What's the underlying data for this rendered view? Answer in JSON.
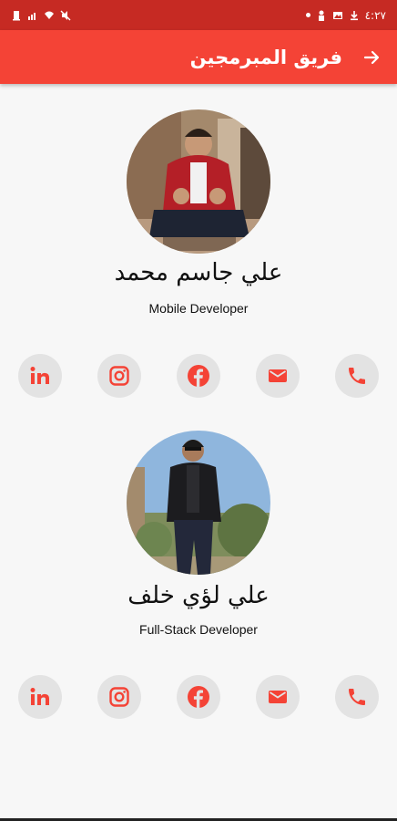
{
  "status_bar": {
    "time": "٤:٢٧",
    "icons_left": [
      "notification-icon",
      "signal-icon",
      "wifi-icon",
      "mute-icon"
    ],
    "icons_right": [
      "dot-icon",
      "person-icon",
      "image-icon",
      "download-icon"
    ]
  },
  "app_bar": {
    "title": "فريق المبرمجين",
    "back_icon": "arrow-right-icon",
    "color": "#f44336"
  },
  "members": [
    {
      "name": "علي جاسم محمد",
      "role": "Mobile Developer"
    },
    {
      "name": "علي لؤي خلف",
      "role": "Full-Stack Developer"
    }
  ],
  "social_icons": [
    "linkedin-icon",
    "instagram-icon",
    "facebook-icon",
    "email-icon",
    "phone-icon"
  ],
  "colors": {
    "primary": "#f44336",
    "status_bar": "#c62a23",
    "icon_bg": "#e3e3e3"
  }
}
